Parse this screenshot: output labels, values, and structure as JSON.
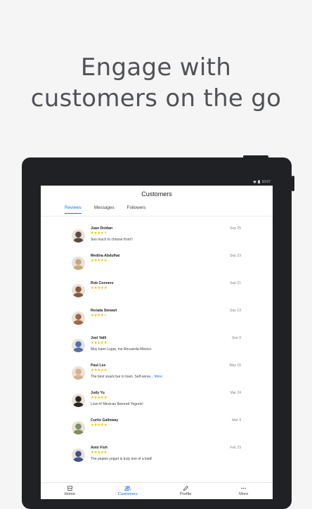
{
  "headline": {
    "line1": "Engage with",
    "line2": "customers on the go"
  },
  "statusbar": {
    "time": "10:07",
    "icons": [
      "wifi-icon",
      "battery-icon"
    ]
  },
  "app": {
    "title": "Customers",
    "tabs": [
      {
        "label": "Reviews",
        "active": true
      },
      {
        "label": "Messages",
        "active": false
      },
      {
        "label": "Followers",
        "active": false
      }
    ]
  },
  "reviews": [
    {
      "name": "Juan Doldan",
      "date": "Sep 25",
      "stars": 4,
      "text": "Soo much to choose from!!",
      "more": "",
      "avatar_color": "#5b4a3f"
    },
    {
      "name": "Medina Abdulhai",
      "date": "Sep 23",
      "stars": 5,
      "text": "",
      "more": "",
      "avatar_color": "#c9a77d"
    },
    {
      "name": "Rob Conners",
      "date": "Sep 21",
      "stars": 5,
      "text": "",
      "more": "",
      "avatar_color": "#8a5a3c"
    },
    {
      "name": "Renata Stewart",
      "date": "Sep 19",
      "stars": 4,
      "text": "",
      "more": "",
      "avatar_color": "#a0673f"
    },
    {
      "name": "Joel Valli",
      "date": "Sep 9",
      "stars": 5,
      "text": "Muy buen Lugar, me Recuerda México.",
      "more": "",
      "avatar_color": "#4f6fa8"
    },
    {
      "name": "Paul Lee",
      "date": "May 16",
      "stars": 5,
      "text": "The best snack bar in town. Self-serve...",
      "more": "More",
      "avatar_color": "#d8b08c"
    },
    {
      "name": "Judy Yu",
      "date": "Mar 24",
      "stars": 5,
      "text": "Love it! Mexican flavored Yogurts!",
      "more": "",
      "avatar_color": "#2b2622"
    },
    {
      "name": "Curtis Galloway",
      "date": "Mar 4",
      "stars": 5,
      "text": "",
      "more": "",
      "avatar_color": "#7f8f5a"
    },
    {
      "name": "Amir Fish",
      "date": "Feb 23",
      "stars": 5,
      "text": "The pepino yogurt is truly one of a kind!",
      "more": "",
      "avatar_color": "#3f4f8f"
    }
  ],
  "bottom_nav": [
    {
      "label": "Home",
      "icon": "storefront-icon",
      "active": false
    },
    {
      "label": "Customers",
      "icon": "people-icon",
      "active": true
    },
    {
      "label": "Profile",
      "icon": "pencil-icon",
      "active": false
    },
    {
      "label": "More",
      "icon": "more-horizontal-icon",
      "active": false
    }
  ],
  "colors": {
    "accent": "#1a73e8",
    "star": "#fbbc04",
    "device": "#202124"
  }
}
